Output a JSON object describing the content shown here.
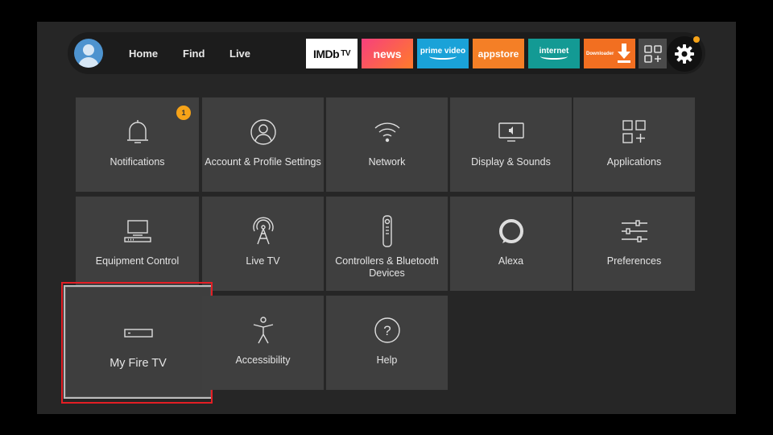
{
  "nav": {
    "home": "Home",
    "find": "Find",
    "live": "Live"
  },
  "apps": {
    "imdb": "IMDb",
    "imdb_tv": "TV",
    "news": "news",
    "prime": "prime video",
    "appstore": "appstore",
    "internet": "internet",
    "downloader": "Downloader"
  },
  "notifications_badge": "1",
  "tiles": {
    "notifications": "Notifications",
    "account": "Account & Profile Settings",
    "network": "Network",
    "display": "Display & Sounds",
    "applications": "Applications",
    "equipment": "Equipment Control",
    "livetv": "Live TV",
    "controllers": "Controllers & Bluetooth Devices",
    "alexa": "Alexa",
    "preferences": "Preferences",
    "myfiretv": "My Fire TV",
    "accessibility": "Accessibility",
    "help": "Help"
  },
  "colors": {
    "highlight": "#e31e24",
    "badge": "#f6a318",
    "prime": "#1aa2d8",
    "appstore": "#f47f26",
    "internet": "#139a94"
  },
  "icons": [
    "bell-icon",
    "person-icon",
    "wifi-icon",
    "display-icon",
    "grid-plus-icon",
    "equipment-icon",
    "broadcast-tower-icon",
    "remote-icon",
    "alexa-ring-icon",
    "sliders-icon",
    "firetv-stick-icon",
    "accessibility-icon",
    "help-icon",
    "gear-icon"
  ]
}
